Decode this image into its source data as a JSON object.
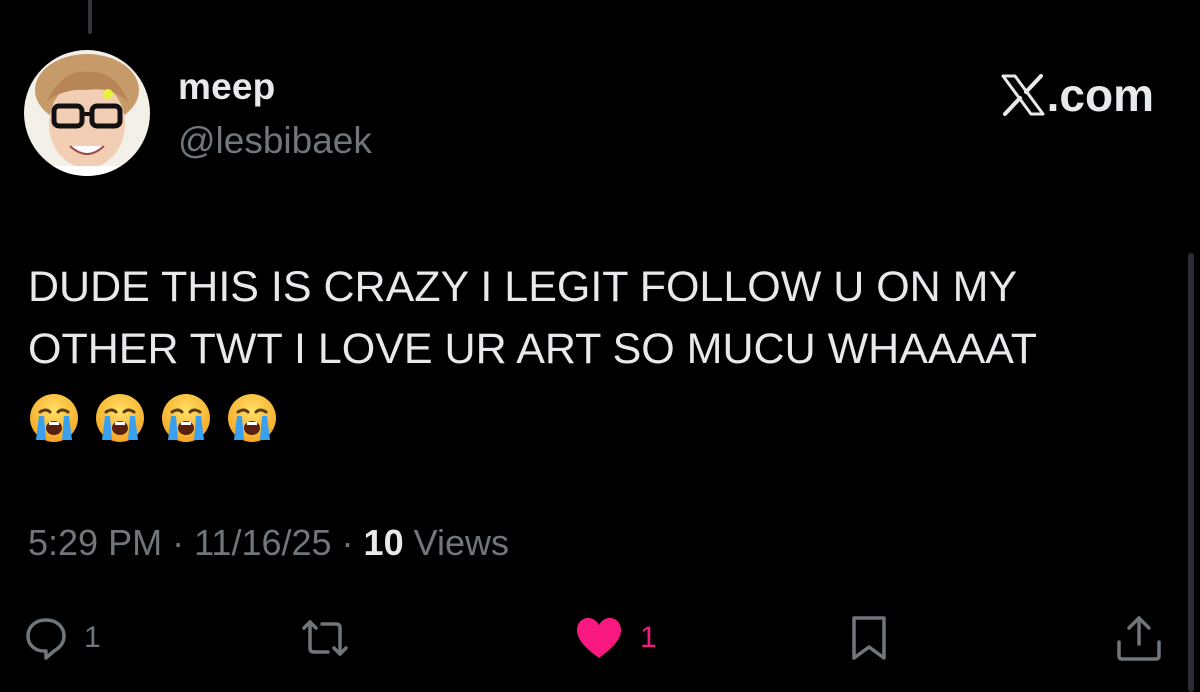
{
  "author": {
    "display_name": "meep",
    "handle": "@lesbibaek"
  },
  "source": {
    "label": ".com",
    "icon": "x-logo-icon"
  },
  "tweet": {
    "text": "DUDE THIS IS CRAZY I LEGIT FOLLOW U ON MY\nOTHER TWT I LOVE UR ART SO MUCU WHAAAAT",
    "emojis": [
      "loudly-crying-face",
      "loudly-crying-face",
      "loudly-crying-face",
      "loudly-crying-face"
    ]
  },
  "meta": {
    "time": "5:29 PM",
    "separator": " · ",
    "date": "11/16/25",
    "views_count": "10",
    "views_label": "Views"
  },
  "actions": {
    "reply": {
      "icon": "reply-icon",
      "count": "1"
    },
    "repost": {
      "icon": "repost-icon",
      "count": ""
    },
    "like": {
      "icon": "heart-icon",
      "count": "1",
      "liked": true
    },
    "bookmark": {
      "icon": "bookmark-icon"
    },
    "share": {
      "icon": "share-icon"
    }
  },
  "colors": {
    "background": "#000000",
    "primary_text": "#e7e9ea",
    "secondary_text": "#71767b",
    "like": "#f91880"
  }
}
